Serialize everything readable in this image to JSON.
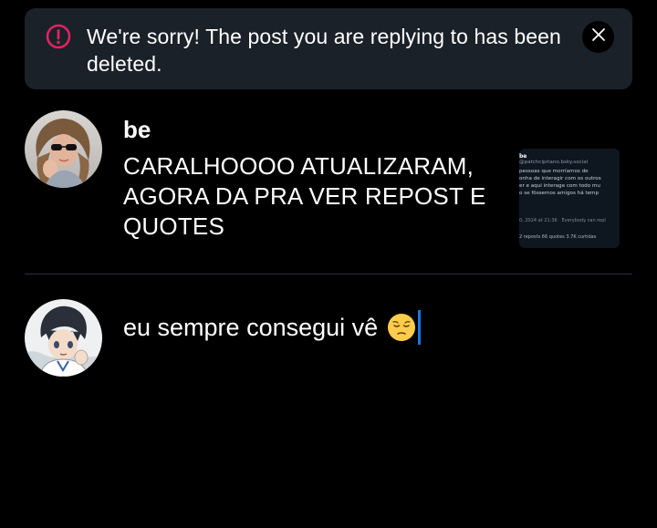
{
  "banner": {
    "message": "We're sorry! The post you are replying to has been deleted.",
    "icon": "alert-circle-icon",
    "icon_color": "#e0245e",
    "close_icon": "close-icon",
    "background": "#1b2129"
  },
  "post": {
    "author": "be",
    "text": "CARALHOOOO ATUALIZARAM, AGORA DA PRA VER REPOST E QUOTES",
    "thumbnail": {
      "handle": "be",
      "username": "@patchcipriano.bsky.social",
      "lines": [
        "pessoas que morríamos de",
        "onha de interagir com os outros",
        "er e aqui interage com todo mu",
        "o se fôssemos amigos há temp"
      ],
      "timestamp": "0, 2024 at 21:36",
      "audience": "Everybody can repl",
      "stats": "2 reposts  66 quotes  3.7K curtidas"
    }
  },
  "reply": {
    "text": "eu sempre consegui vê",
    "emoji": "pensive-face"
  },
  "colors": {
    "background": "#000000",
    "divider": "#2c333c",
    "caret": "#1a73e8"
  }
}
